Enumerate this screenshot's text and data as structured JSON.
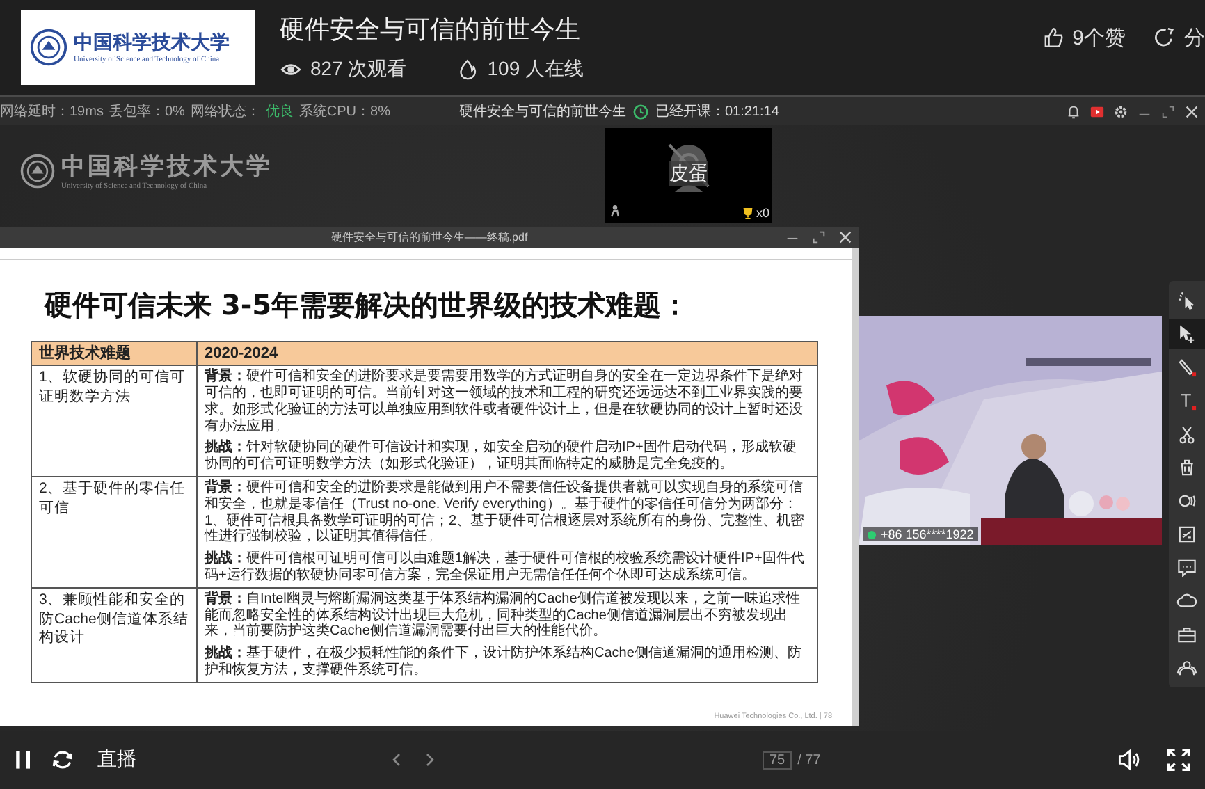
{
  "header": {
    "logo": {
      "name_cn": "中国科学技术大学",
      "name_en": "University of Science and Technology of China"
    },
    "title": "硬件安全与可信的前世今生",
    "views": "827 次观看",
    "online": "109 人在线",
    "likes": "9个赞",
    "share": "分"
  },
  "status_bar": {
    "stats": [
      "网络延时：19ms",
      "丢包率：0%"
    ],
    "network_label": "网络状态：",
    "network_value": "优良",
    "cpu": "系统CPU：8%",
    "title": "硬件安全与可信的前世今生",
    "elapsed": "已经开课：01:21:14"
  },
  "stage": {
    "logo": {
      "name_cn": "中国科学技术大学",
      "name_en": "University of Science and Technology of China"
    },
    "camera": {
      "name": "皮蛋",
      "trophies": "x0"
    },
    "document": {
      "title": "硬件安全与可信的前世今生——终稿.pdf",
      "heading": "硬件可信未来 3-5年需要解决的世界级的技术难题：",
      "columns": [
        "世界技术难题",
        "2020-2024"
      ],
      "rows": [
        {
          "problem": "1、软硬协同的可信可证明数学方法",
          "paragraphs": [
            "**背景：**硬件可信和安全的进阶要求是要需要用数学的方式证明自身的安全在一定边界条件下是绝对可信的，也即可证明的可信。当前针对这一领域的技术和工程的研究还远远达不到工业界实践的要求。如形式化验证的方法可以单独应用到软件或者硬件设计上，但是在软硬协同的设计上暂时还没有办法应用。",
            "**挑战：**针对软硬协同的硬件可信设计和实现，如安全启动的硬件启动IP+固件启动代码，形成软硬协同的可信可证明数学方法（如形式化验证），证明其面临特定的威胁是完全免疫的。"
          ]
        },
        {
          "problem": "2、基于硬件的零信任可信",
          "paragraphs": [
            "**背景：**硬件可信和安全的进阶要求是能做到用户不需要信任设备提供者就可以实现自身的系统可信和安全，也就是零信任（Trust no-one. Verify everything）。基于硬件的零信任可信分为两部分：1、硬件可信根具备数学可证明的可信；2、基于硬件可信根逐层对系统所有的身份、完整性、机密性进行强制校验，以证明其值得信任。",
            "**挑战：**硬件可信根可证明可信可以由难题1解决，基于硬件可信根的校验系统需设计硬件IP+固件代码+运行数据的软硬协同零可信方案，完全保证用户无需信任任何个体即可达成系统可信。"
          ]
        },
        {
          "problem": "3、兼顾性能和安全的防Cache侧信道体系结构设计",
          "paragraphs": [
            "**背景：**自Intel幽灵与熔断漏洞这类基于体系结构漏洞的Cache侧信道被发现以来，之前一味追求性能而忽略安全性的体系结构设计出现巨大危机，同种类型的Cache侧信道漏洞层出不穷被发现出来，当前要防护这类Cache侧信道漏洞需要付出巨大的性能代价。",
            "**挑战：**基于硬件，在极少损耗性能的条件下，设计防护体系结构Cache侧信道漏洞的通用检测、防护和恢复方法，支撑硬件系统可信。"
          ]
        }
      ],
      "footer": "Huawei Technologies Co., Ltd. | 78",
      "page": "75",
      "total": "/ 77"
    },
    "video": {
      "caller": "+86 156****1922"
    },
    "tools": [
      {
        "kind": "laser",
        "selected": false
      },
      {
        "kind": "select",
        "selected": true
      },
      {
        "kind": "pen",
        "selected": false
      },
      {
        "kind": "text",
        "selected": false
      },
      {
        "kind": "scissors",
        "selected": false
      },
      {
        "kind": "trash",
        "selected": false
      },
      {
        "kind": "record",
        "selected": false
      },
      {
        "kind": "formula",
        "selected": false
      },
      {
        "kind": "chat",
        "selected": false
      },
      {
        "kind": "cloud",
        "selected": false
      },
      {
        "kind": "toolbox",
        "selected": false
      },
      {
        "kind": "people",
        "selected": false
      }
    ]
  },
  "controls": {
    "live_label": "直播"
  }
}
